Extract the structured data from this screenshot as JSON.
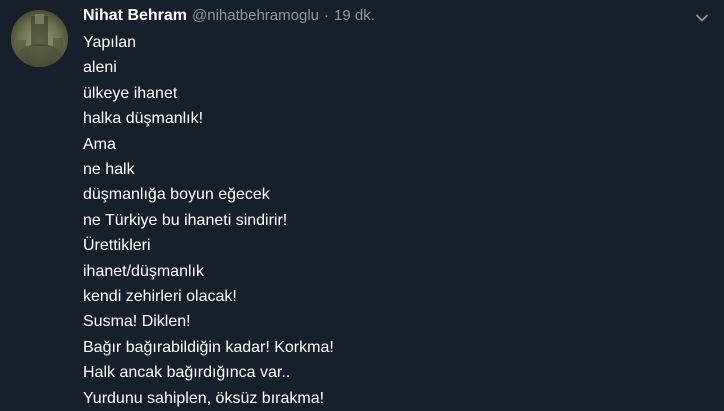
{
  "tweet": {
    "author_name": "Nihat Behram",
    "author_handle": "@nihatbehramoglu",
    "separator": "·",
    "time": "19 dk.",
    "lines": [
      "Yapılan",
      "aleni",
      "ülkeye ihanet",
      "halka düşmanlık!",
      "Ama",
      "ne halk",
      "düşmanlığa boyun eğecek",
      "ne Türkiye bu ihaneti sindirir!",
      "Ürettikleri",
      "ihanet/düşmanlık",
      "kendi zehirleri olacak!",
      "Susma! Diklen!",
      "Bağır bağırabildiğin kadar! Korkma!",
      "Halk ancak bağırdığınca var..",
      "Yurdunu sahiplen, öksüz bırakma!"
    ]
  },
  "icons": {
    "avatar": "profile-photo",
    "menu": "chevron-down-icon"
  },
  "colors": {
    "background": "#15202b",
    "text": "#ffffff",
    "secondary": "#8899a6"
  }
}
